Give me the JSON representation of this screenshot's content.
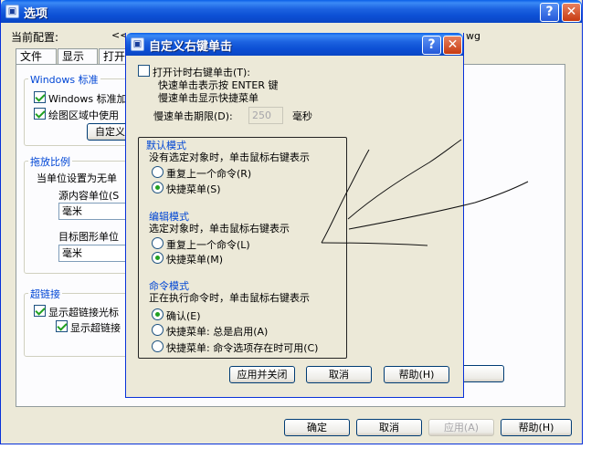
{
  "options_window": {
    "title": "选项",
    "help_symbol": "?",
    "close_symbol": "✕",
    "current_profile_label": "当前配置:",
    "current_profile_value": "<<",
    "drawing_name_fragment": "wg",
    "tabs": [
      "文件",
      "显示",
      "打开"
    ],
    "windows_group": {
      "legend": "Windows 标准",
      "check1": "Windows 标准加",
      "check2": "绘图区域中使用",
      "custom_button": "自定义右"
    },
    "scale_group": {
      "legend": "拖放比例",
      "desc": "当单位设置为无单",
      "source_label": "源内容单位(S",
      "source_value": "毫米",
      "target_label": "目标图形单位",
      "target_value": "毫米"
    },
    "hyperlink_group": {
      "legend": "超链接",
      "check1": "显示超链接光标",
      "check2": "显示超链接"
    },
    "buttons": {
      "ok": "确定",
      "cancel": "取消",
      "apply": "应用(A)",
      "help": "帮助(H)"
    }
  },
  "dialog": {
    "title": "自定义右键单击",
    "help_symbol": "?",
    "close_symbol": "✕",
    "timed_check_label": "打开计时右键单击(T):",
    "quick_desc": "快速单击表示按 ENTER 键",
    "slow_desc": "慢速单击显示快捷菜单",
    "duration_label": "慢速单击期限(D):",
    "duration_value": "250",
    "duration_unit": "毫秒",
    "default_mode": {
      "title": "默认模式",
      "desc": "没有选定对象时，单击鼠标右键表示",
      "options": [
        "重复上一个命令(R)",
        "快捷菜单(S)"
      ],
      "selected_index": 1
    },
    "edit_mode": {
      "title": "编辑模式",
      "desc": "选定对象时，单击鼠标右键表示",
      "options": [
        "重复上一个命令(L)",
        "快捷菜单(M)"
      ],
      "selected_index": 1
    },
    "command_mode": {
      "title": "命令模式",
      "desc": "正在执行命令时，单击鼠标右键表示",
      "options": [
        "确认(E)",
        "快捷菜单: 总是启用(A)",
        "快捷菜单: 命令选项存在时可用(C)"
      ],
      "selected_index": 0
    },
    "buttons": {
      "apply_close": "应用并关闭",
      "cancel": "取消",
      "help": "帮助(H)"
    }
  }
}
